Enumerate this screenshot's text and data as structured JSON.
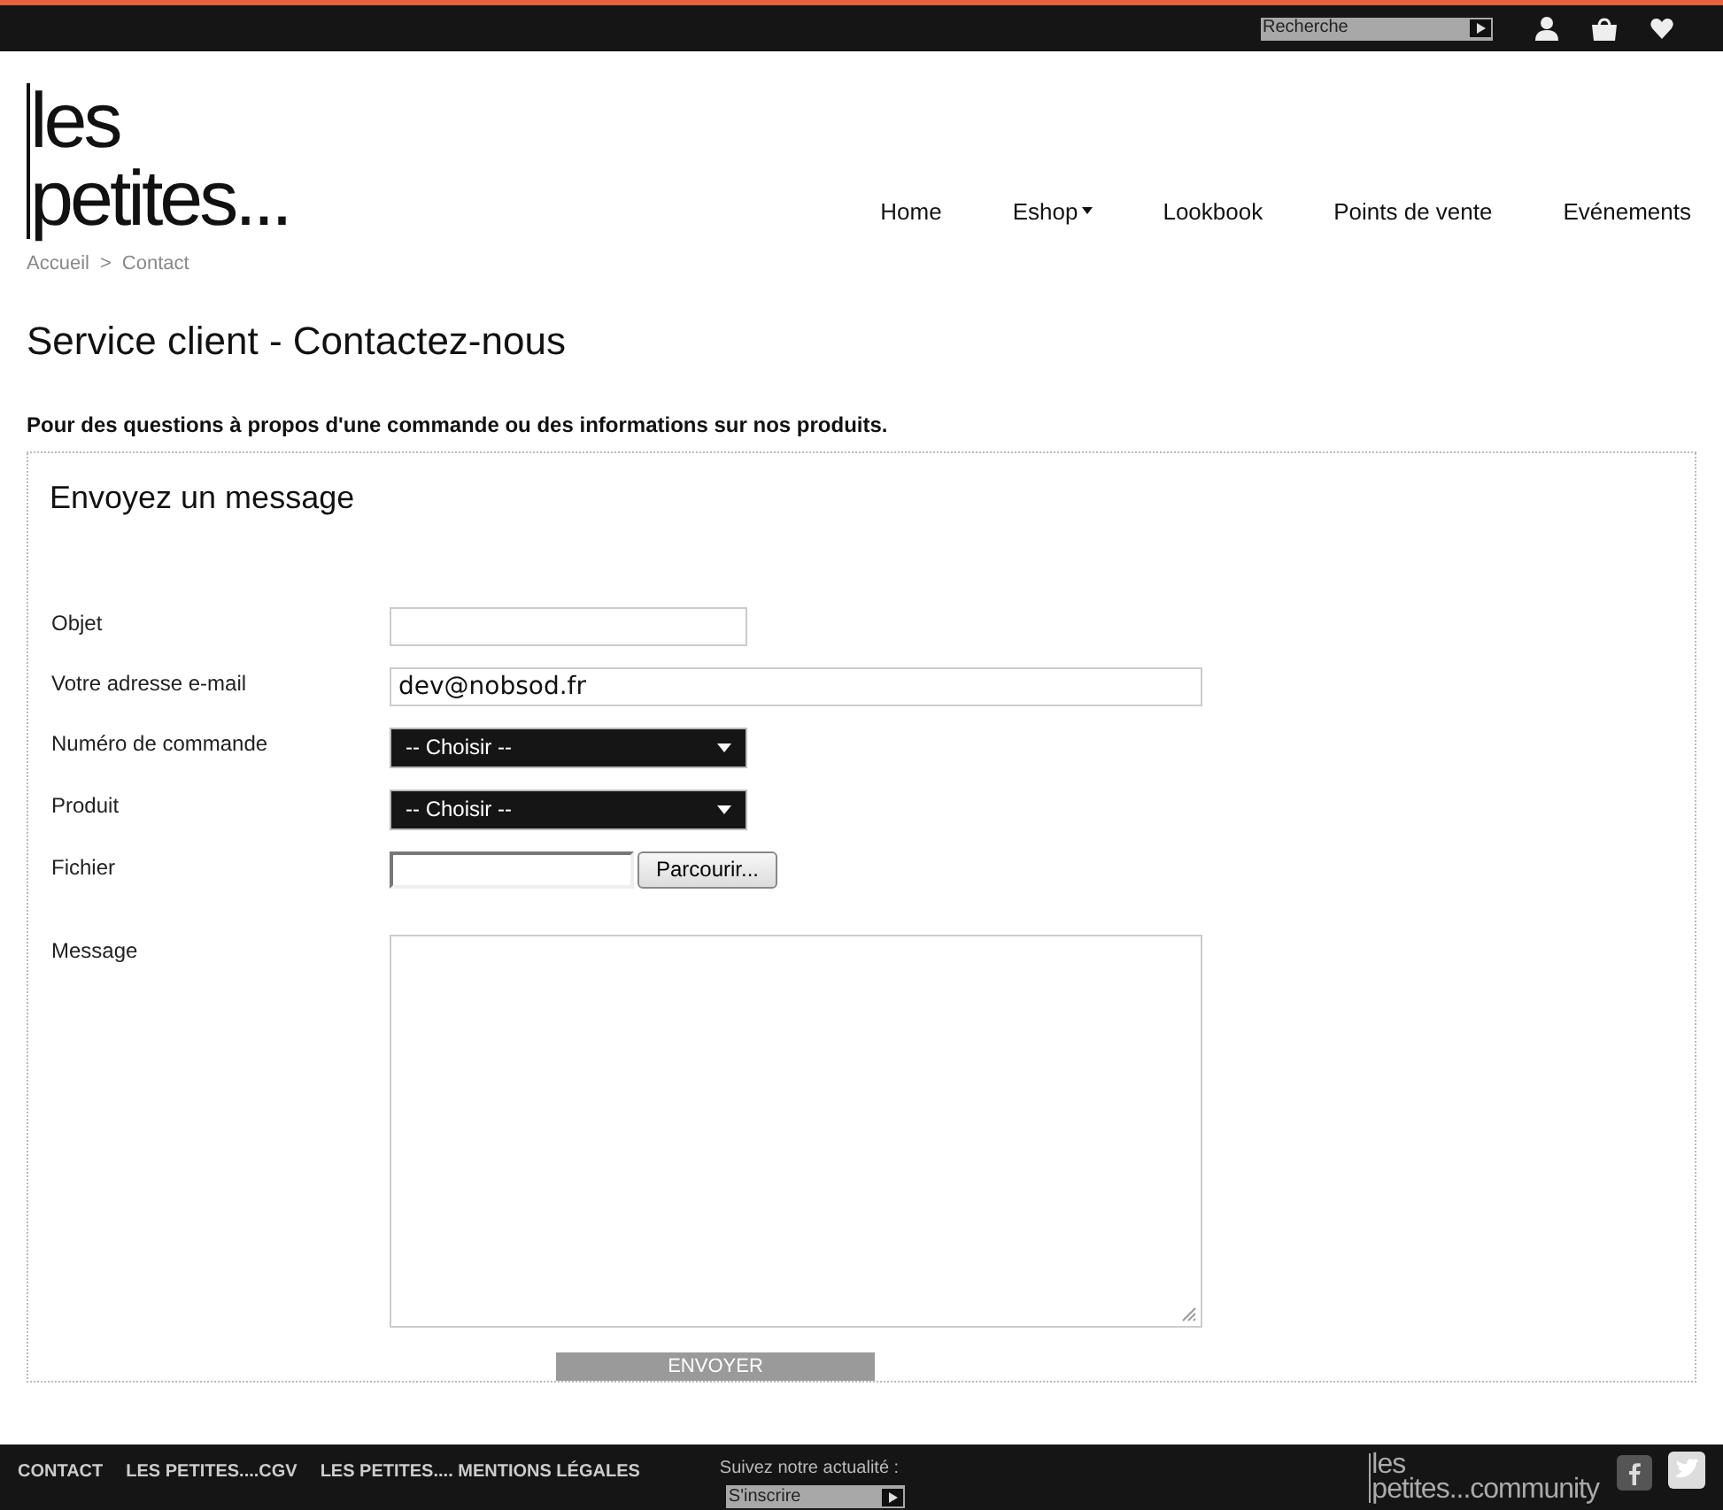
{
  "topbar": {
    "search": {
      "placeholder": "Recherche"
    }
  },
  "logo": {
    "line_1": "les",
    "line_2": "petites..."
  },
  "nav": [
    {
      "label": "Home",
      "dropdown": false
    },
    {
      "label": "Eshop",
      "dropdown": true
    },
    {
      "label": "Lookbook",
      "dropdown": false
    },
    {
      "label": "Points de vente",
      "dropdown": false
    },
    {
      "label": "Evénements",
      "dropdown": false
    }
  ],
  "breadcrumb": [
    "Accueil",
    "Contact"
  ],
  "breadcrumb_separator": ">",
  "title": "Service client - Contactez-nous",
  "intro": "Pour des questions à propos d'une commande ou des informations sur nos produits.",
  "form": {
    "title": "Envoyez un message",
    "fields": [
      {
        "kind": "text",
        "label": "Objet",
        "wide": false
      },
      {
        "kind": "text",
        "label": "Votre adresse e-mail",
        "value": "dev@nobsod.fr",
        "wide": true
      },
      {
        "kind": "select",
        "label": "Numéro de commande",
        "value": "-- Choisir --"
      },
      {
        "kind": "select",
        "label": "Produit",
        "value": "-- Choisir --"
      },
      {
        "kind": "file",
        "label": "Fichier",
        "button": "Parcourir..."
      },
      {
        "kind": "textarea",
        "label": "Message"
      }
    ],
    "submit": "ENVOYER"
  },
  "footer": {
    "links": [
      "CONTACT",
      "LES PETITES....CGV",
      "LES PETITES.... MENTIONS LÉGALES"
    ],
    "follow": "Suivez notre actualité :",
    "subscribe": {
      "placeholder": "S'inscrire"
    },
    "brand_line_1": "les",
    "brand_line_2": "petites...community"
  }
}
